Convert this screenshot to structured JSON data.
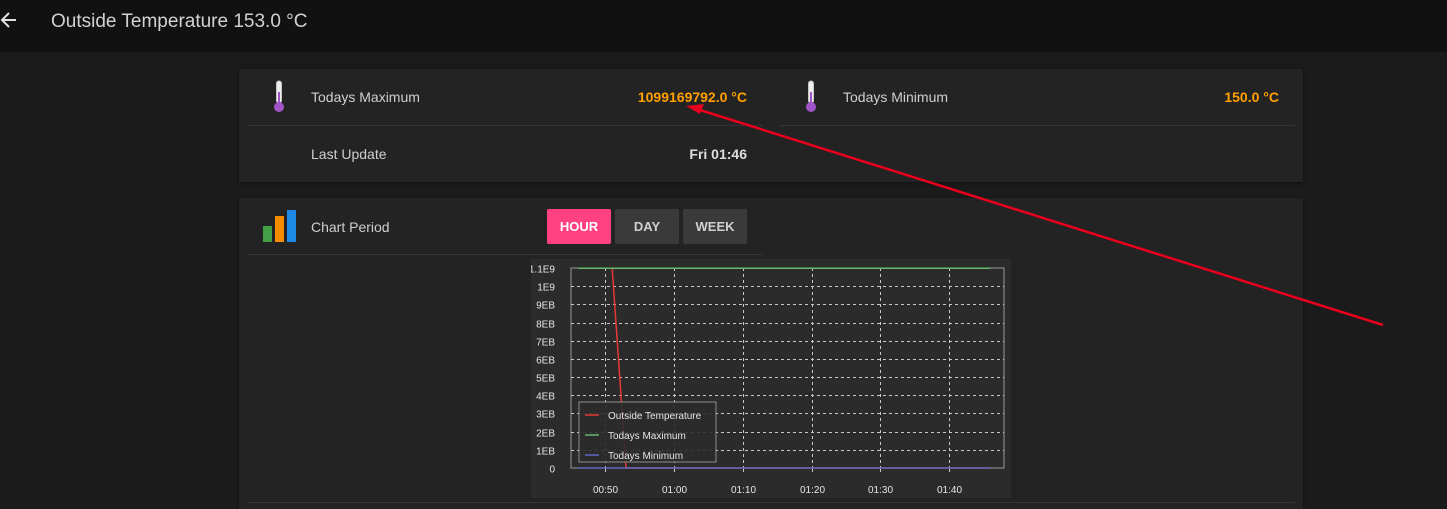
{
  "header": {
    "title": "Outside Temperature 153.0 °C",
    "back_icon": "arrow-left-icon"
  },
  "stats": {
    "max_label": "Todays Maximum",
    "max_value": "1099169792.0 °C",
    "min_label": "Todays Minimum",
    "min_value": "150.0 °C",
    "update_label": "Last Update",
    "update_value": "Fri 01:46",
    "icon": "thermometer-icon"
  },
  "period": {
    "label": "Chart Period",
    "icon": "bar-chart-icon",
    "options": [
      "HOUR",
      "DAY",
      "WEEK"
    ],
    "selected": "HOUR"
  },
  "colors": {
    "accent": "#ff4081",
    "value": "#ffa000",
    "annotation": "#e8001c"
  },
  "chart_data": {
    "type": "line",
    "x_ticks": [
      "00:50",
      "01:00",
      "01:10",
      "01:20",
      "01:30",
      "01:40"
    ],
    "y_ticks": [
      "0",
      "1EB",
      "2EB",
      "3EB",
      "4EB",
      "5EB",
      "6EB",
      "7EB",
      "8EB",
      "9EB",
      "1E9",
      "1.1E9"
    ],
    "x_range": [
      "00:45",
      "01:48"
    ],
    "ylim": [
      0,
      1100000000
    ],
    "grid": true,
    "legend_position": "bottom-left",
    "series": [
      {
        "name": "Outside Temperature",
        "color": "#e53935",
        "points": [
          [
            "00:46",
            1099169792
          ],
          [
            "00:47",
            1099169792
          ],
          [
            "00:48",
            1099169792
          ],
          [
            "00:49",
            1099169792
          ],
          [
            "00:50",
            1099169792
          ],
          [
            "00:51",
            1099169792
          ],
          [
            "00:53",
            153
          ],
          [
            "01:46",
            153
          ]
        ]
      },
      {
        "name": "Todays Maximum",
        "color": "#66bb6a",
        "points": [
          [
            "00:46",
            1099169792
          ],
          [
            "01:46",
            1099169792
          ]
        ]
      },
      {
        "name": "Todays Minimum",
        "color": "#5c6bc0",
        "points": [
          [
            "00:46",
            150
          ],
          [
            "01:46",
            150
          ]
        ]
      }
    ]
  }
}
